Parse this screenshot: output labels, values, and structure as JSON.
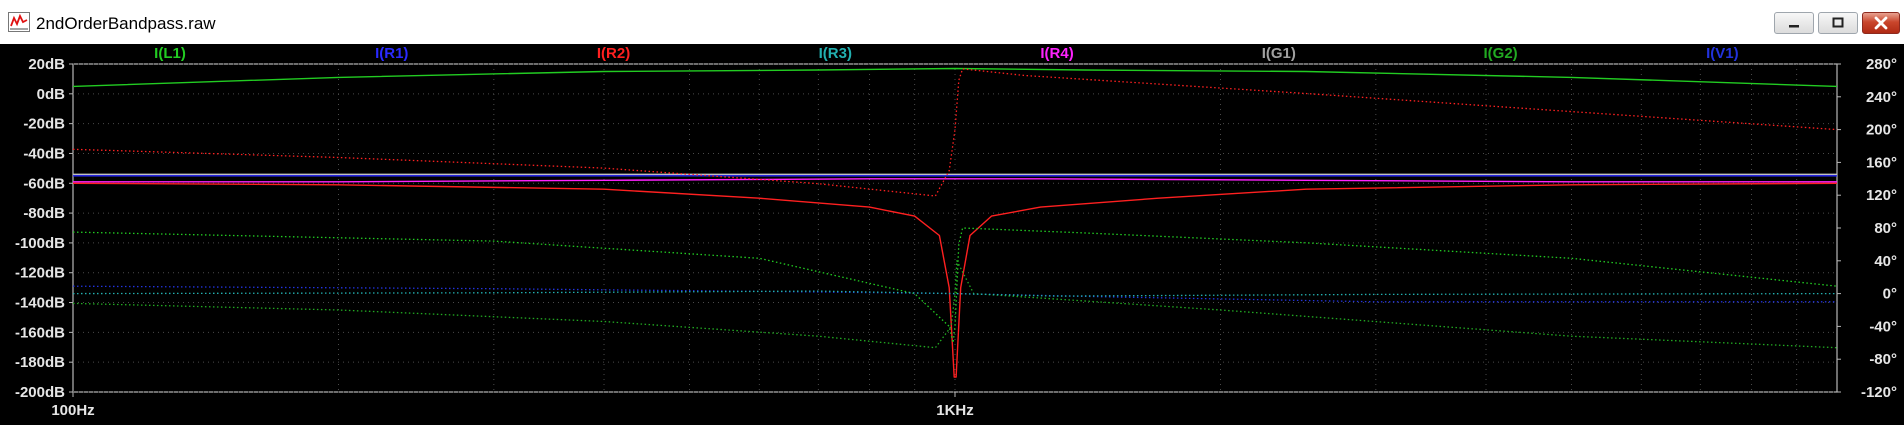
{
  "window": {
    "title": "2ndOrderBandpass.raw"
  },
  "chart_data": {
    "type": "line",
    "x_scale": "log",
    "x_range_hz": [
      100,
      10000
    ],
    "x_ticks": [
      {
        "value": 100,
        "label": "100Hz"
      },
      {
        "value": 1000,
        "label": "1KHz"
      }
    ],
    "y_left": {
      "range": [
        -200,
        20
      ],
      "ticks": [
        {
          "value": 20,
          "label": "20dB"
        },
        {
          "value": 0,
          "label": "0dB"
        },
        {
          "value": -20,
          "label": "-20dB"
        },
        {
          "value": -40,
          "label": "-40dB"
        },
        {
          "value": -60,
          "label": "-60dB"
        },
        {
          "value": -80,
          "label": "-80dB"
        },
        {
          "value": -100,
          "label": "-100dB"
        },
        {
          "value": -120,
          "label": "-120dB"
        },
        {
          "value": -140,
          "label": "-140dB"
        },
        {
          "value": -160,
          "label": "-160dB"
        },
        {
          "value": -180,
          "label": "-180dB"
        },
        {
          "value": -200,
          "label": "-200dB"
        }
      ]
    },
    "y_right": {
      "range": [
        -120,
        280
      ],
      "ticks": [
        {
          "value": 280,
          "label": "280°"
        },
        {
          "value": 240,
          "label": "240°"
        },
        {
          "value": 200,
          "label": "200°"
        },
        {
          "value": 160,
          "label": "160°"
        },
        {
          "value": 120,
          "label": "120°"
        },
        {
          "value": 80,
          "label": "80°"
        },
        {
          "value": 40,
          "label": "40°"
        },
        {
          "value": 0,
          "label": "0°"
        },
        {
          "value": -40,
          "label": "-40°"
        },
        {
          "value": -80,
          "label": "-80°"
        },
        {
          "value": -120,
          "label": "-120°"
        }
      ]
    },
    "grid": true,
    "legend": [
      {
        "label": "I(L1)",
        "color": "#22cc22"
      },
      {
        "label": "I(R1)",
        "color": "#2a2aff"
      },
      {
        "label": "I(R2)",
        "color": "#ff2020"
      },
      {
        "label": "I(R3)",
        "color": "#22b0b0"
      },
      {
        "label": "I(R4)",
        "color": "#ff22ff"
      },
      {
        "label": "I(G1)",
        "color": "#a0a0a0"
      },
      {
        "label": "I(G2)",
        "color": "#22aa22"
      },
      {
        "label": "I(V1)",
        "color": "#2233dd"
      }
    ],
    "series": [
      {
        "name": "I(G1)",
        "color": "#c0c0c0",
        "style": "solid",
        "axis": "left",
        "points": [
          [
            100,
            -54
          ],
          [
            10000,
            -54
          ]
        ]
      },
      {
        "name": "I(R1)",
        "color": "#2a2aff",
        "style": "solid",
        "axis": "left",
        "points": [
          [
            100,
            -55
          ],
          [
            1000,
            -55
          ],
          [
            10000,
            -55
          ]
        ]
      },
      {
        "name": "I(R4)",
        "color": "#ff22ff",
        "style": "solid",
        "axis": "left",
        "points": [
          [
            100,
            -59
          ],
          [
            200,
            -59
          ],
          [
            400,
            -58
          ],
          [
            800,
            -57
          ],
          [
            1000,
            -57
          ],
          [
            1250,
            -57
          ],
          [
            2500,
            -58
          ],
          [
            5000,
            -59
          ],
          [
            10000,
            -59
          ]
        ]
      },
      {
        "name": "I(R2)",
        "color": "#ff2020",
        "style": "solid",
        "axis": "left",
        "points": [
          [
            100,
            -60
          ],
          [
            200,
            -61
          ],
          [
            400,
            -64
          ],
          [
            600,
            -70
          ],
          [
            800,
            -76
          ],
          [
            900,
            -82
          ],
          [
            960,
            -95
          ],
          [
            985,
            -130
          ],
          [
            998,
            -190
          ],
          [
            1003,
            -190
          ],
          [
            1015,
            -130
          ],
          [
            1040,
            -95
          ],
          [
            1100,
            -82
          ],
          [
            1250,
            -76
          ],
          [
            1700,
            -70
          ],
          [
            2500,
            -64
          ],
          [
            5000,
            -61
          ],
          [
            10000,
            -60
          ]
        ]
      },
      {
        "name": "I(L1)",
        "color": "#22cc22",
        "style": "solid",
        "axis": "left",
        "points": [
          [
            100,
            5
          ],
          [
            200,
            11
          ],
          [
            400,
            15
          ],
          [
            700,
            16
          ],
          [
            1000,
            17
          ],
          [
            1400,
            16
          ],
          [
            2500,
            15
          ],
          [
            5000,
            11
          ],
          [
            10000,
            5
          ]
        ]
      },
      {
        "name": "I(R2) phase",
        "color": "#ff2020",
        "style": "dotted",
        "axis": "right",
        "points": [
          [
            100,
            176
          ],
          [
            200,
            166
          ],
          [
            400,
            153
          ],
          [
            700,
            134
          ],
          [
            950,
            119
          ],
          [
            985,
            150
          ],
          [
            1000,
            200
          ],
          [
            1010,
            260
          ],
          [
            1020,
            274
          ],
          [
            1200,
            266
          ],
          [
            2500,
            244
          ],
          [
            5000,
            222
          ],
          [
            10000,
            200
          ]
        ]
      },
      {
        "name": "I(L1) phase",
        "color": "#22cc22",
        "style": "dotted",
        "axis": "right",
        "points": [
          [
            100,
            75
          ],
          [
            300,
            64
          ],
          [
            600,
            43
          ],
          [
            900,
            0
          ],
          [
            985,
            -40
          ],
          [
            995,
            -60
          ],
          [
            1000,
            -40
          ],
          [
            1010,
            60
          ],
          [
            1020,
            80
          ],
          [
            1400,
            74
          ],
          [
            2500,
            62
          ],
          [
            5000,
            43
          ],
          [
            10000,
            9
          ]
        ]
      },
      {
        "name": "I(G2) phase",
        "color": "#22aa22",
        "style": "dotted",
        "axis": "right",
        "points": [
          [
            100,
            -12
          ],
          [
            200,
            -20
          ],
          [
            400,
            -34
          ],
          [
            700,
            -52
          ],
          [
            950,
            -66
          ],
          [
            990,
            -40
          ],
          [
            1000,
            0
          ],
          [
            1005,
            40
          ],
          [
            1050,
            0
          ],
          [
            2000,
            -20
          ],
          [
            5000,
            -52
          ],
          [
            10000,
            -66
          ]
        ]
      },
      {
        "name": "I(V1) phase",
        "color": "#2233dd",
        "style": "dotted",
        "axis": "right",
        "points": [
          [
            100,
            9
          ],
          [
            300,
            6
          ],
          [
            700,
            2
          ],
          [
            1000,
            0
          ],
          [
            1500,
            -4
          ],
          [
            3000,
            -10
          ],
          [
            10000,
            -10
          ]
        ]
      },
      {
        "name": "I(R3) phase",
        "color": "#22b0b0",
        "style": "dotted",
        "axis": "right",
        "points": [
          [
            100,
            0
          ],
          [
            300,
            1
          ],
          [
            700,
            3
          ],
          [
            1000,
            0
          ],
          [
            1300,
            -3
          ],
          [
            3000,
            -1
          ],
          [
            10000,
            0
          ]
        ]
      }
    ]
  }
}
